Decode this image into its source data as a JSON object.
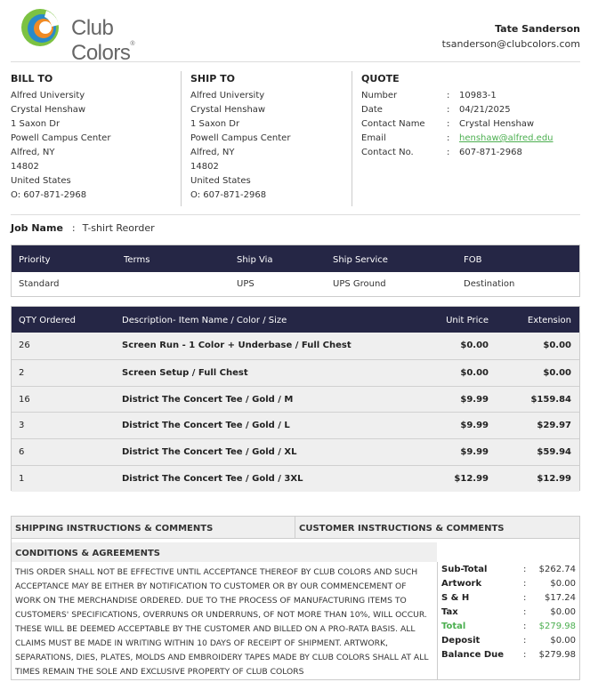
{
  "header": {
    "logo_text": "Club Colors",
    "logo_tm": "®",
    "user_name": "Tate Sanderson",
    "user_email": "tsanderson@clubcolors.com"
  },
  "bill_to": {
    "title": "BILL TO",
    "lines": [
      "Alfred University",
      "Crystal Henshaw",
      "1 Saxon Dr",
      "Powell Campus Center",
      "Alfred, NY",
      "14802",
      "United States",
      "O: 607-871-2968"
    ]
  },
  "ship_to": {
    "title": "SHIP TO",
    "lines": [
      "Alfred University",
      "Crystal Henshaw",
      "1 Saxon Dr",
      "Powell Campus Center",
      "Alfred, NY",
      "14802",
      "United States",
      "O: 607-871-2968"
    ]
  },
  "quote": {
    "title": "QUOTE",
    "rows": [
      {
        "label": "Number",
        "value": "10983-1"
      },
      {
        "label": "Date",
        "value": "04/21/2025"
      },
      {
        "label": "Contact Name",
        "value": "Crystal Henshaw"
      },
      {
        "label": "Email",
        "value": "henshaw@alfred.edu"
      },
      {
        "label": "Contact No.",
        "value": "607-871-2968"
      }
    ]
  },
  "job": {
    "label": "Job Name",
    "value": "T-shirt Reorder"
  },
  "shipping": {
    "headers": [
      "Priority",
      "Terms",
      "Ship Via",
      "Ship Service",
      "FOB"
    ],
    "values": [
      "Standard",
      "",
      "UPS",
      "UPS Ground",
      "Destination"
    ]
  },
  "items": {
    "headers": [
      "QTY Ordered",
      "Description- Item Name / Color / Size",
      "Unit Price",
      "Extension"
    ],
    "rows": [
      {
        "qty": "26",
        "desc": "Screen Run - 1 Color + Underbase / Full Chest",
        "price": "$0.00",
        "ext": "$0.00"
      },
      {
        "qty": "2",
        "desc": "Screen Setup / Full Chest",
        "price": "$0.00",
        "ext": "$0.00"
      },
      {
        "qty": "16",
        "desc": "District The Concert Tee / Gold / M",
        "price": "$9.99",
        "ext": "$159.84"
      },
      {
        "qty": "3",
        "desc": "District The Concert Tee / Gold / L",
        "price": "$9.99",
        "ext": "$29.97"
      },
      {
        "qty": "6",
        "desc": "District The Concert Tee / Gold / XL",
        "price": "$9.99",
        "ext": "$59.94"
      },
      {
        "qty": "1",
        "desc": "District The Concert Tee / Gold / 3XL",
        "price": "$12.99",
        "ext": "$12.99"
      }
    ]
  },
  "comments": {
    "shipping_instructions": "SHIPPING INSTRUCTIONS & COMMENTS",
    "customer_instructions": "CUSTOMER INSTRUCTIONS & COMMENTS",
    "conditions_title": "CONDITIONS & AGREEMENTS",
    "conditions_text": "THIS ORDER SHALL NOT BE EFFECTIVE UNTIL ACCEPTANCE THEREOF BY CLUB COLORS AND SUCH ACCEPTANCE MAY BE EITHER BY NOTIFICATION TO CUSTOMER OR BY OUR COMMENCEMENT OF WORK ON THE MERCHANDISE ORDERED. DUE TO THE PROCESS OF MANUFACTURING ITEMS TO CUSTOMERS' SPECIFICATIONS, OVERRUNS OR UNDERRUNS, OF NOT MORE THAN 10%, WILL OCCUR. THESE WILL BE DEEMED ACCEPTABLE BY THE CUSTOMER AND BILLED ON A PRO-RATA BASIS. ALL CLAIMS MUST BE MADE IN WRITING WITHIN 10 DAYS OF RECEIPT OF SHIPMENT. ARTWORK, SEPARATIONS, DIES, PLATES, MOLDS AND EMBROIDERY TAPES MADE BY CLUB COLORS SHALL AT ALL TIMES REMAIN THE SOLE AND EXCLUSIVE PROPERTY OF CLUB COLORS"
  },
  "totals": [
    {
      "label": "Sub-Total",
      "value": "$262.74",
      "highlight": false
    },
    {
      "label": "Artwork",
      "value": "$0.00",
      "highlight": false
    },
    {
      "label": "S & H",
      "value": "$17.24",
      "highlight": false
    },
    {
      "label": "Tax",
      "value": "$0.00",
      "highlight": false
    },
    {
      "label": "Total",
      "value": "$279.98",
      "highlight": true
    },
    {
      "label": "Deposit",
      "value": "$0.00",
      "highlight": false
    },
    {
      "label": "Balance Due",
      "value": "$279.98",
      "highlight": false
    }
  ],
  "colors": {
    "header_bg": "#252645",
    "accent_green": "#4caf50",
    "row_bg": "#efefef",
    "logo_green": "#7cc242",
    "logo_blue": "#2a8ac9",
    "logo_orange": "#f08a24"
  }
}
